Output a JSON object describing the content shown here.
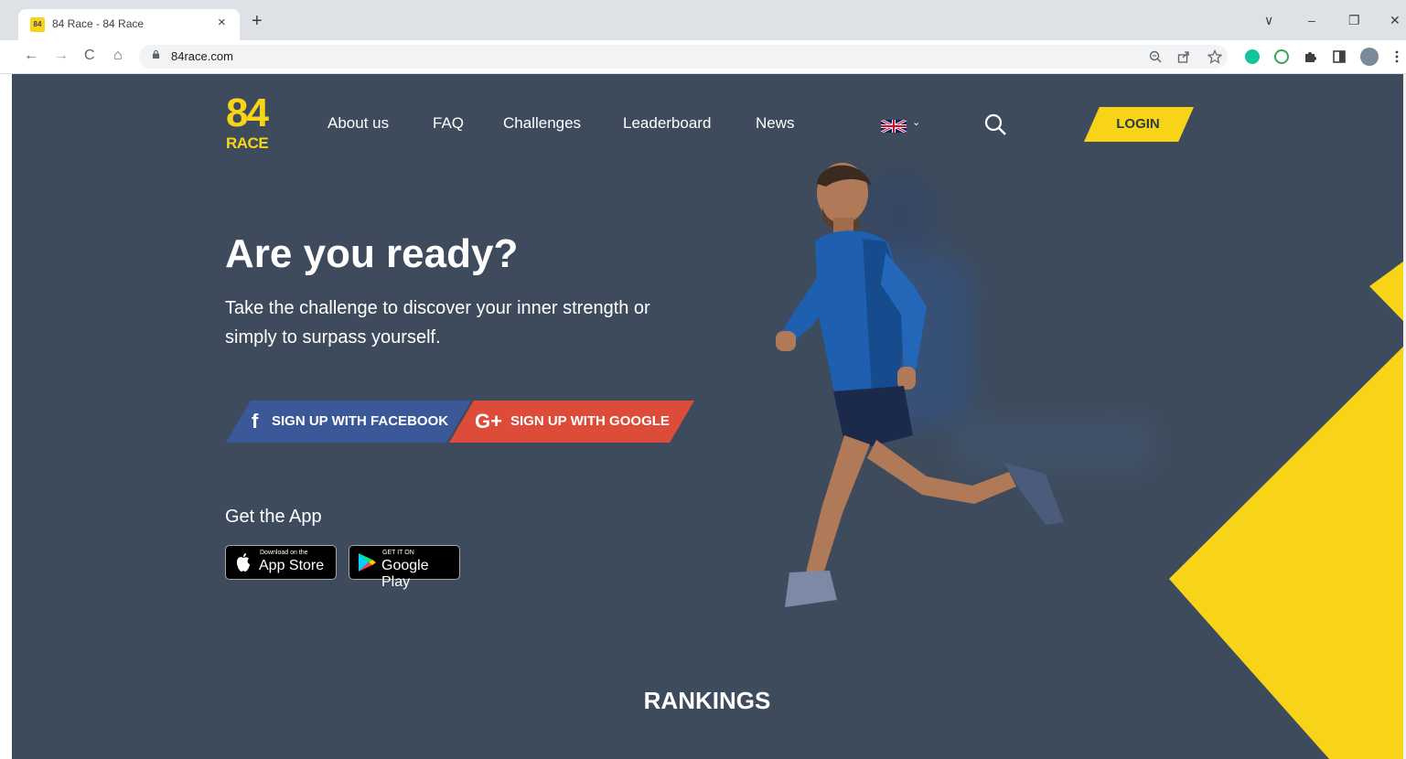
{
  "browser": {
    "tab_title": "84 Race - 84 Race",
    "tab_close": "×",
    "new_tab": "+",
    "url": "84race.com",
    "back": "←",
    "forward": "→",
    "reload": "C",
    "home": "⌂",
    "window_controls": [
      "∨",
      "–",
      "❐",
      "✕"
    ]
  },
  "logo": {
    "number": "84",
    "word": "RACE"
  },
  "nav": {
    "links": [
      "About us",
      "FAQ",
      "Challenges",
      "Leaderboard",
      "News"
    ],
    "lang_chevron": "⌄",
    "login": "LOGIN"
  },
  "hero": {
    "title": "Are you ready?",
    "subtitle": "Take the challenge to discover your inner strength or simply to surpass yourself."
  },
  "signup": {
    "facebook_icon": "f",
    "facebook": "SIGN UP WITH FACEBOOK",
    "google_icon": "G+",
    "google": "SIGN UP WITH GOOGLE"
  },
  "app": {
    "title": "Get the App",
    "appstore_small": "Download on the",
    "appstore_big": "App Store",
    "googleplay_small": "GET IT ON",
    "googleplay_big": "Google Play"
  },
  "rankings": {
    "title": "RANKINGS"
  },
  "colors": {
    "page_bg": "#3d4b5c",
    "brand_yellow": "#f7d417",
    "facebook_blue": "#3b5998",
    "google_red": "#dd4b39"
  }
}
